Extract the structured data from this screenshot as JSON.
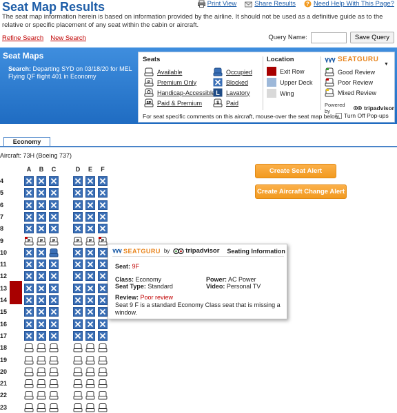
{
  "header": {
    "title": "Seat Map Results",
    "links": [
      "Print View",
      "Share Results",
      "Need Help With This Page?"
    ],
    "disclaimer": "The seat map information herein is based on information provided by the airline. It should not be used as a definitive guide as to the relative or specific placement of any seat within the cabin or aircraft.",
    "refine": "Refine Search",
    "new_search": "New Search",
    "query_label": "Query Name:",
    "query_value": "",
    "save_button": "Save Query"
  },
  "band": {
    "title": "Seat Maps",
    "search_label": "Search:",
    "search_text": "Departing SYD on 03/18/20 for MEL Flying QF flight 401 in Economy"
  },
  "legend": {
    "seats_heading": "Seats",
    "location_heading": "Location",
    "seats": [
      {
        "label": "Available",
        "icon": "available-seat-icon"
      },
      {
        "label": "Premium Only",
        "icon": "premium-seat-icon"
      },
      {
        "label": "Handicap-Accessible",
        "icon": "handicap-seat-icon"
      },
      {
        "label": "Paid & Premium",
        "icon": "paid-premium-seat-icon"
      }
    ],
    "seats2": [
      {
        "label": "Occupied",
        "icon": "occupied-seat-icon"
      },
      {
        "label": "Blocked",
        "icon": "blocked-seat-icon"
      },
      {
        "label": "Lavatory",
        "icon": "lavatory-icon"
      },
      {
        "label": "Paid",
        "icon": "paid-seat-icon"
      }
    ],
    "locations": [
      {
        "label": "Exit Row",
        "color": "#a80000"
      },
      {
        "label": "Upper Deck",
        "color": "#9db8d9"
      },
      {
        "label": "Wing",
        "color": "#d9d9d9"
      }
    ],
    "seatguru": "SEATGURU",
    "reviews": [
      "Good Review",
      "Poor Review",
      "Mixed Review"
    ],
    "powered_by": "Powered by",
    "tripadvisor": "tripadvisor",
    "note": "For seat specific comments on this aircraft, mouse-over the seat map below.",
    "popups": "Turn Off Pop-ups"
  },
  "tab": {
    "label": "Economy"
  },
  "aircraft": "Aircraft: 73H (Boeing 737)",
  "seatmap": {
    "columns": [
      "A",
      "B",
      "C",
      "D",
      "E",
      "F"
    ],
    "rows": [
      "4",
      "5",
      "6",
      "7",
      "8",
      "9",
      "10",
      "11",
      "12",
      "13",
      "14",
      "15",
      "16",
      "17",
      "18",
      "19",
      "20",
      "21",
      "22",
      "23"
    ]
  },
  "actions": {
    "seat_alert": "Create Seat Alert",
    "change_alert": "Create Aircraft Change Alert"
  },
  "tooltip": {
    "seatguru": "SEATGURU",
    "by": "by",
    "tripadvisor": "tripadvisor",
    "heading": "Seating Information",
    "seat_label": "Seat:",
    "seat_value": "9F",
    "class_label": "Class:",
    "class_value": "Economy",
    "type_label": "Seat Type:",
    "type_value": "Standard",
    "power_label": "Power:",
    "power_value": "AC Power",
    "video_label": "Video:",
    "video_value": "Personal TV",
    "review_label": "Review:",
    "review_value": "Poor review",
    "description": "Seat 9 F is a standard Economy Class seat that is missing a window."
  },
  "colors": {
    "accent": "#1f5ea8",
    "exit": "#a80000",
    "button": "#f29a1f",
    "blocked": "#3a6fb6"
  }
}
